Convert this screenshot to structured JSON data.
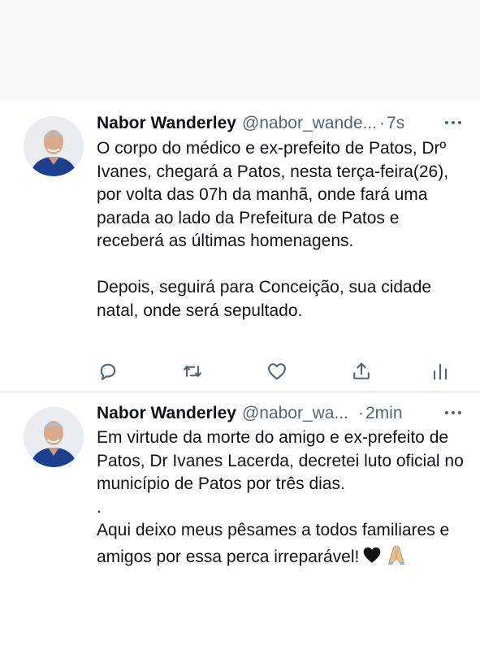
{
  "colors": {
    "text": "#0f1419",
    "secondary": "#536471",
    "background": "#ffffff",
    "page": "#f7f7f7",
    "avatar_shirt": "#1d3f8f"
  },
  "tweets": [
    {
      "author_name": "Nabor Wanderley",
      "handle": "@nabor_wande...",
      "separator": "·",
      "time": "7s",
      "paragraphs": [
        "O corpo do médico e ex-prefeito de Patos, Drº Ivanes, chegará a Patos, nesta terça-feira(26), por volta das 07h da manhã, onde fará uma parada ao lado da Prefeitura de Patos e receberá as últimas homenagens.",
        "Depois, seguirá para Conceição, sua cidade natal, onde será sepultado."
      ],
      "icons": [
        "avatar",
        "more-icon",
        "reply-icon",
        "retweet-icon",
        "like-icon",
        "share-icon",
        "analytics-icon"
      ]
    },
    {
      "author_name": "Nabor Wanderley",
      "handle": "@nabor_wa...",
      "separator": "·",
      "time": "2min",
      "paragraph_1": "Em virtude da morte do amigo e ex-prefeito de Patos, Dr Ivanes Lacerda, decretei luto oficial no município de Patos por três dias.",
      "dot_line": ".",
      "paragraph_2": "Aqui deixo meus pêsames a todos familiares e amigos por essa perca irreparável!",
      "emojis": [
        "black-heart-icon",
        "folded-hands-icon"
      ]
    }
  ]
}
